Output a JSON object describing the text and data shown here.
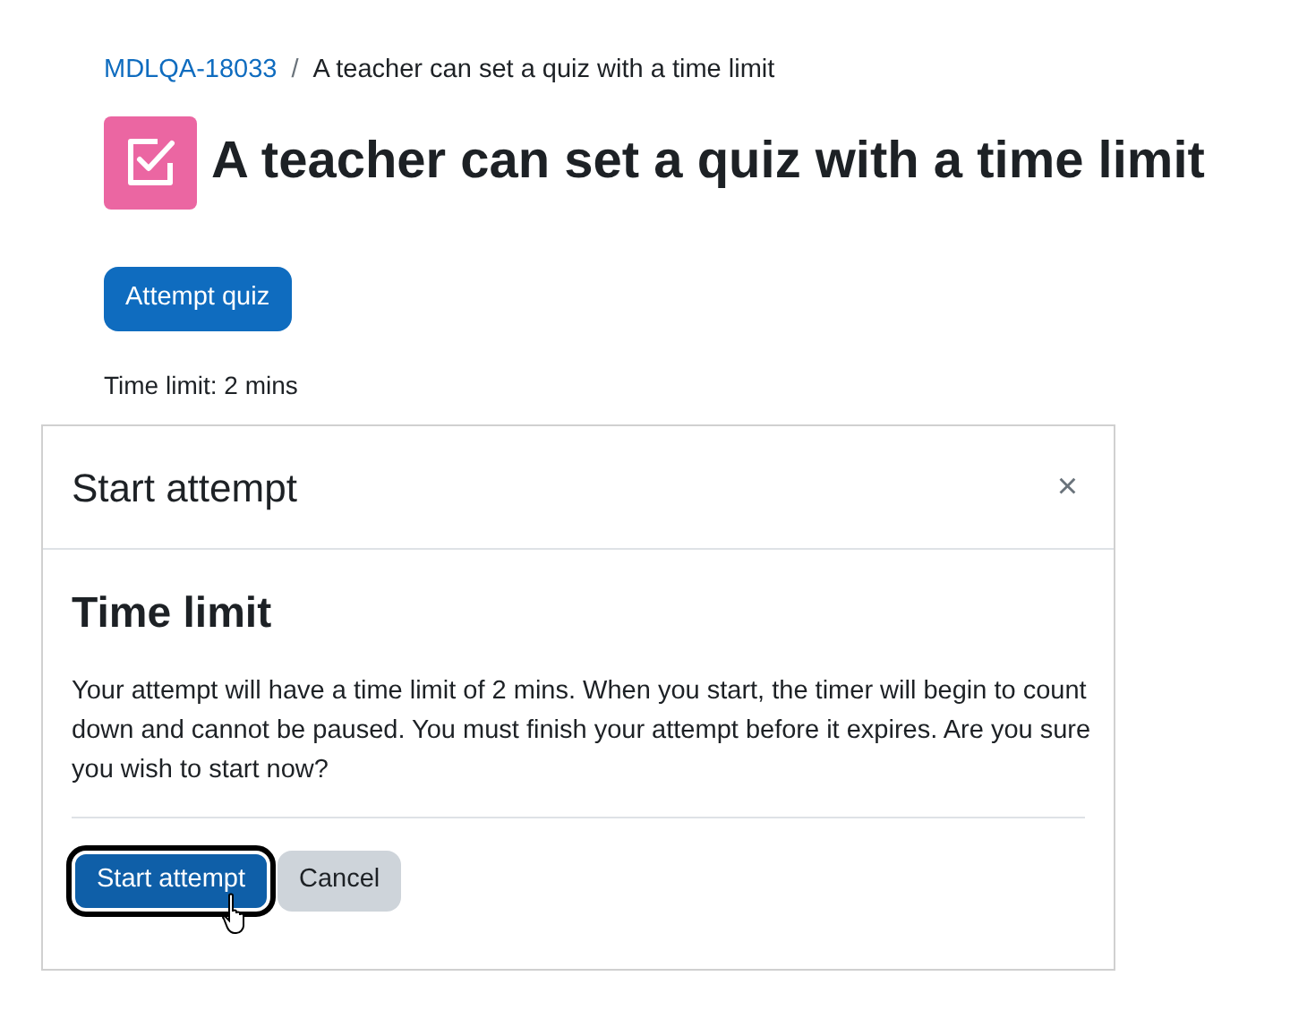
{
  "breadcrumb": [
    {
      "label": "MDLQA-18033",
      "kind": "link"
    },
    {
      "label": "A teacher can set a quiz with a time limit",
      "kind": "current"
    }
  ],
  "separator": "/",
  "page_title": "A teacher can set a quiz with a time limit",
  "attempt_button": "Attempt quiz",
  "time_limit": "Time limit: 2 mins",
  "dialog": {
    "title": "Start attempt",
    "close": "×",
    "heading": "Time limit",
    "message": "Your attempt will have a time limit of 2 mins. When you start, the timer will begin to count down and cannot be paused. You must finish your attempt before it expires. Are you sure you wish to start now?",
    "buttons": [
      {
        "label": "Start attempt",
        "kind": "primary",
        "focused": true
      },
      {
        "label": "Cancel",
        "kind": "secondary",
        "focused": false
      }
    ]
  }
}
